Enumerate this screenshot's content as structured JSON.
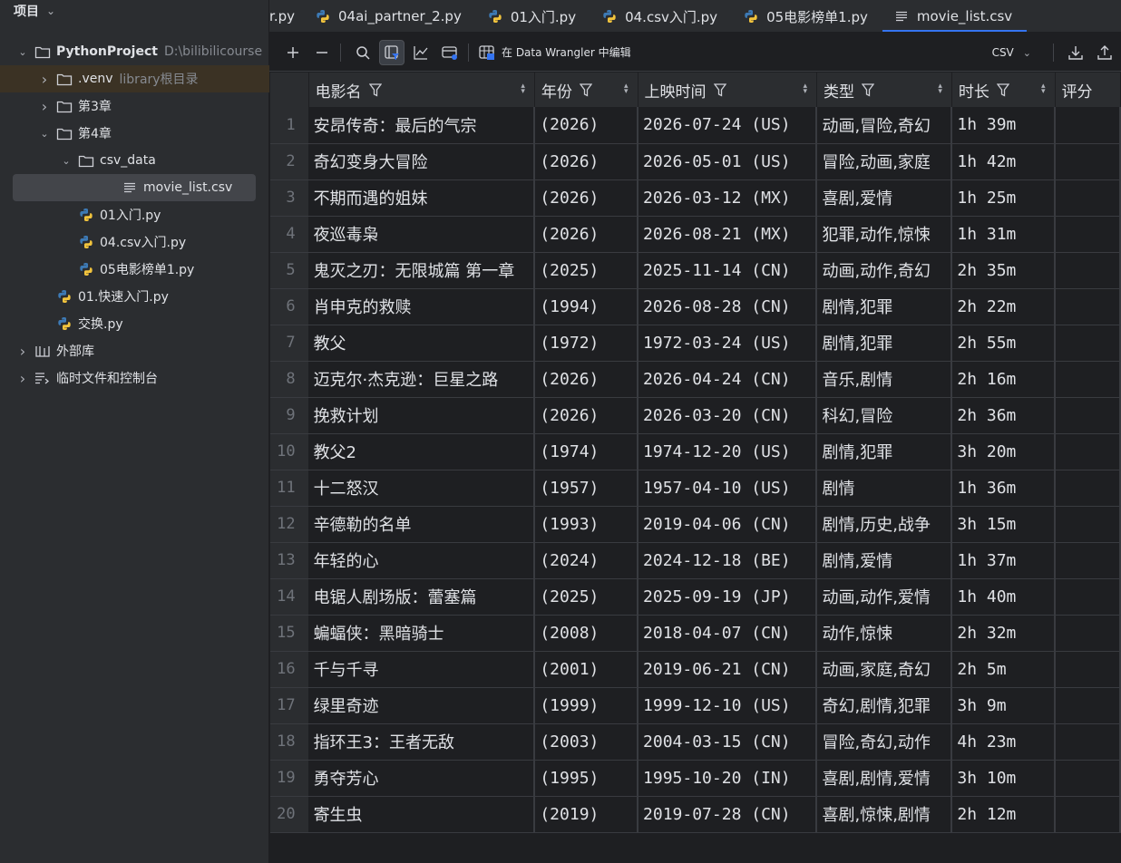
{
  "sidebar": {
    "title": "项目",
    "tree": [
      {
        "label": "PythonProject",
        "sub": "D:\\bilibilicourse",
        "kind": "folder",
        "indent": 0,
        "arrow": "down",
        "bold": true
      },
      {
        "label": ".venv",
        "sub": "library根目录",
        "kind": "folder",
        "indent": 1,
        "arrow": "right",
        "highlight": true
      },
      {
        "label": "第3章",
        "kind": "folder",
        "indent": 1,
        "arrow": "right"
      },
      {
        "label": "第4章",
        "kind": "folder",
        "indent": 1,
        "arrow": "down"
      },
      {
        "label": "csv_data",
        "kind": "folder",
        "indent": 2,
        "arrow": "down"
      },
      {
        "label": "movie_list.csv",
        "kind": "csv",
        "indent": 3,
        "selected": true
      },
      {
        "label": "01入门.py",
        "kind": "py",
        "indent": 2
      },
      {
        "label": "04.csv入门.py",
        "kind": "py",
        "indent": 2
      },
      {
        "label": "05电影榜单1.py",
        "kind": "py",
        "indent": 2
      },
      {
        "label": "01.快速入门.py",
        "kind": "py",
        "indent": 1
      },
      {
        "label": "交换.py",
        "kind": "py",
        "indent": 1
      },
      {
        "label": "外部库",
        "kind": "lib",
        "indent": 0,
        "arrow": "right"
      },
      {
        "label": "临时文件和控制台",
        "kind": "scratch",
        "indent": 0,
        "arrow": "right"
      }
    ]
  },
  "tabs": [
    {
      "label": "r.py",
      "icon": "python",
      "partial": true
    },
    {
      "label": "04ai_partner_2.py",
      "icon": "python"
    },
    {
      "label": "01入门.py",
      "icon": "python"
    },
    {
      "label": "04.csv入门.py",
      "icon": "python"
    },
    {
      "label": "05电影榜单1.py",
      "icon": "python"
    },
    {
      "label": "movie_list.csv",
      "icon": "csv",
      "active": true
    }
  ],
  "toolbar": {
    "wrangler_label": "在 Data Wrangler 中编辑",
    "format": "CSV"
  },
  "table": {
    "columns": [
      "电影名",
      "年份",
      "上映时间",
      "类型",
      "时长",
      "评分"
    ],
    "rows": [
      [
        "1",
        "安昂传奇：最后的气宗",
        "(2026)",
        "2026-07-24 (US)",
        "动画,冒险,奇幻",
        "1h 39m"
      ],
      [
        "2",
        "奇幻变身大冒险",
        "(2026)",
        "2026-05-01 (US)",
        "冒险,动画,家庭",
        "1h 42m"
      ],
      [
        "3",
        "不期而遇的姐妹",
        "(2026)",
        "2026-03-12 (MX)",
        "喜剧,爱情",
        "1h 25m"
      ],
      [
        "4",
        "夜巡毒枭",
        "(2026)",
        "2026-08-21 (MX)",
        "犯罪,动作,惊悚",
        "1h 31m"
      ],
      [
        "5",
        "鬼灭之刃：无限城篇 第一章",
        "(2025)",
        "2025-11-14 (CN)",
        "动画,动作,奇幻",
        "2h 35m"
      ],
      [
        "6",
        "肖申克的救赎",
        "(1994)",
        "2026-08-28 (CN)",
        "剧情,犯罪",
        "2h 22m"
      ],
      [
        "7",
        "教父",
        "(1972)",
        "1972-03-24 (US)",
        "剧情,犯罪",
        "2h 55m"
      ],
      [
        "8",
        "迈克尔·杰克逊：巨星之路",
        "(2026)",
        "2026-04-24 (CN)",
        "音乐,剧情",
        "2h 16m"
      ],
      [
        "9",
        "挽救计划",
        "(2026)",
        "2026-03-20 (CN)",
        "科幻,冒险",
        "2h 36m"
      ],
      [
        "10",
        "教父2",
        "(1974)",
        "1974-12-20 (US)",
        "剧情,犯罪",
        "3h 20m"
      ],
      [
        "11",
        "十二怒汉",
        "(1957)",
        "1957-04-10 (US)",
        "剧情",
        "1h 36m"
      ],
      [
        "12",
        "辛德勒的名单",
        "(1993)",
        "2019-04-06 (CN)",
        "剧情,历史,战争",
        "3h 15m"
      ],
      [
        "13",
        "年轻的心",
        "(2024)",
        "2024-12-18 (BE)",
        "剧情,爱情",
        "1h 37m"
      ],
      [
        "14",
        "电锯人剧场版：蕾塞篇",
        "(2025)",
        "2025-09-19 (JP)",
        "动画,动作,爱情",
        "1h 40m"
      ],
      [
        "15",
        "蝙蝠侠：黑暗骑士",
        "(2008)",
        "2018-04-07 (CN)",
        "动作,惊悚",
        "2h 32m"
      ],
      [
        "16",
        "千与千寻",
        "(2001)",
        "2019-06-21 (CN)",
        "动画,家庭,奇幻",
        "2h 5m"
      ],
      [
        "17",
        "绿里奇迹",
        "(1999)",
        "1999-12-10 (US)",
        "奇幻,剧情,犯罪",
        "3h 9m"
      ],
      [
        "18",
        "指环王3：王者无敌",
        "(2003)",
        "2004-03-15 (CN)",
        "冒险,奇幻,动作",
        "4h 23m"
      ],
      [
        "19",
        "勇夺芳心",
        "(1995)",
        "1995-10-20 (IN)",
        "喜剧,剧情,爱情",
        "3h 10m"
      ],
      [
        "20",
        "寄生虫",
        "(2019)",
        "2019-07-28 (CN)",
        "喜剧,惊悚,剧情",
        "2h 12m"
      ]
    ]
  }
}
